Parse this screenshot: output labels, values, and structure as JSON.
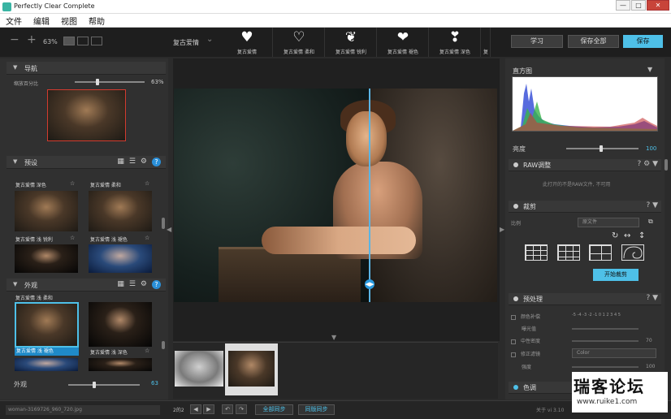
{
  "app_title": "Perfectly Clear Complete",
  "window_buttons": [
    "—",
    "□",
    "✕"
  ],
  "menu": [
    "文件",
    "编辑",
    "视图",
    "帮助"
  ],
  "toolbar": {
    "zoom_value": "63%",
    "preset_name": "复古爱情",
    "learn_label": "学习",
    "save_all_label": "保存全部",
    "save_label": "保存"
  },
  "preset_strip": [
    {
      "icon": "heart-icon",
      "glyph": "♥",
      "label": "复古爱情"
    },
    {
      "icon": "heart-outline-icon",
      "glyph": "♡",
      "label": "复古爱情 柔和"
    },
    {
      "icon": "heart-burst-icon",
      "glyph": "❦",
      "label": "复古爱情 锐利"
    },
    {
      "icon": "heart-split-icon",
      "glyph": "❤",
      "label": "复古爱情 褪色"
    },
    {
      "icon": "heart-pair-icon",
      "glyph": "❣",
      "label": "复古爱情 深色"
    },
    {
      "icon": "more-icon",
      "glyph": "",
      "label": "复"
    }
  ],
  "navigator": {
    "title": "导航",
    "zoom_label": "缩放百分比",
    "zoom_value": "63%",
    "zoom_pct": 0.3
  },
  "presets_section": {
    "title": "预设",
    "top_labels": [
      "复古爱情 深色",
      "复古爱情 柔和"
    ],
    "thumbs": [
      {
        "label": "复古爱情 浅 锐利"
      },
      {
        "label": "复古爱情 浅 褪色"
      }
    ]
  },
  "looks_section": {
    "title": "外观",
    "top_labels": [
      "复古爱情 浅 柔和",
      ""
    ],
    "thumbs": [
      {
        "label": "复古爱情 浅 褪色",
        "selected": true
      },
      {
        "label": "复古爱情 浅 深色"
      }
    ],
    "strength_label": "外观",
    "strength_value": "63",
    "strength_pct": 0.34
  },
  "histogram": {
    "title": "直方图",
    "exposure_label": "亮度",
    "exposure_value": "100",
    "exposure_pct": 0.46
  },
  "raw": {
    "title": "RAW调整",
    "info": "此打开的不是RAW文件, 不可用"
  },
  "crop": {
    "title": "裁剪",
    "ratio_label": "比例",
    "ratio_value": "原文件",
    "button": "开始裁剪"
  },
  "processing": {
    "title": "预处理",
    "rows": [
      {
        "label": "颜色补偿",
        "value": "-5 -4 -3 -2 -1 0 1 2 3 4 5"
      },
      {
        "label": "曝光值",
        "value": ""
      },
      {
        "label": "中性密度",
        "value": "70"
      },
      {
        "label": "修正滤镜",
        "value": "Color"
      },
      {
        "label": "强度",
        "value": "100"
      }
    ]
  },
  "tone": {
    "title": "色调"
  },
  "status": {
    "filename": "woman-3169726_960_720.jpg",
    "page": "2的2",
    "sync_all": "全部同步",
    "sync_same": "同版同步",
    "about": "关于 vi 3.10"
  },
  "watermark": {
    "title": "瑞客论坛",
    "url": "www.ruike1.com"
  }
}
